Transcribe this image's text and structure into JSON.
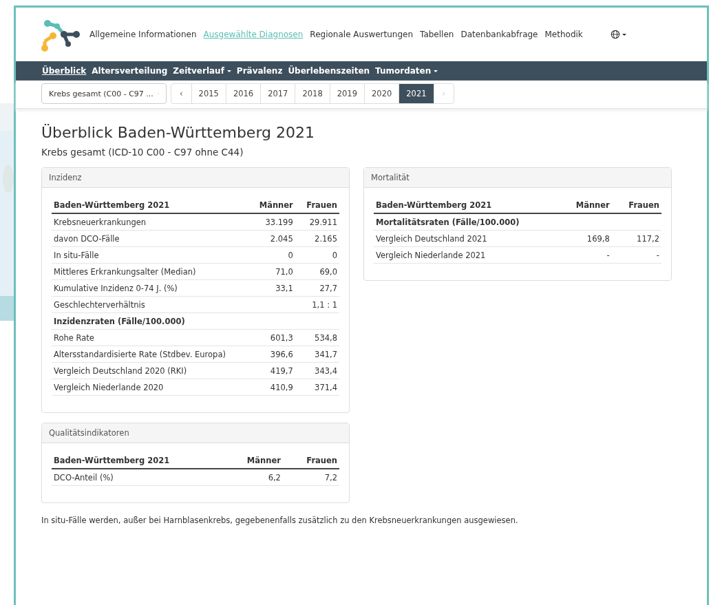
{
  "top_nav": {
    "items": [
      {
        "label": "Allgemeine Informationen",
        "selected": false
      },
      {
        "label": "Ausgewählte Diagnosen",
        "selected": true
      },
      {
        "label": "Regionale Auswertungen",
        "selected": false
      },
      {
        "label": "Tabellen",
        "selected": false
      },
      {
        "label": "Datenbankabfrage",
        "selected": false
      },
      {
        "label": "Methodik",
        "selected": false
      }
    ]
  },
  "sub_nav": {
    "items": [
      {
        "label": "Überblick",
        "selected": true,
        "dropdown": false
      },
      {
        "label": "Altersverteilung",
        "selected": false,
        "dropdown": false
      },
      {
        "label": "Zeitverlauf",
        "selected": false,
        "dropdown": true
      },
      {
        "label": "Prävalenz",
        "selected": false,
        "dropdown": false
      },
      {
        "label": "Überlebenszeiten",
        "selected": false,
        "dropdown": false
      },
      {
        "label": "Tumordaten",
        "selected": false,
        "dropdown": true
      }
    ]
  },
  "diagnosis_select": {
    "value": "Krebs gesamt (C00 - C97 ..."
  },
  "year_pager": {
    "prev": {
      "label": "‹",
      "disabled": false
    },
    "next": {
      "label": "›",
      "disabled": true
    },
    "years": [
      {
        "label": "2015",
        "selected": false
      },
      {
        "label": "2016",
        "selected": false
      },
      {
        "label": "2017",
        "selected": false
      },
      {
        "label": "2018",
        "selected": false
      },
      {
        "label": "2019",
        "selected": false
      },
      {
        "label": "2020",
        "selected": false
      },
      {
        "label": "2021",
        "selected": true
      }
    ]
  },
  "title": "Überblick Baden-Württemberg 2021",
  "subtitle": "Krebs gesamt (ICD-10 C00 - C97 ohne C44)",
  "left_column": {
    "cards": [
      {
        "title": "Inzidenz",
        "columns": [
          "Baden-Württemberg 2021",
          "Männer",
          "Frauen"
        ],
        "rows": [
          {
            "kind": "data",
            "cells": [
              "Krebsneuerkrankungen",
              "33.199",
              "29.911"
            ]
          },
          {
            "kind": "data",
            "cells": [
              "davon DCO-Fälle",
              "2.045",
              "2.165"
            ]
          },
          {
            "kind": "data",
            "cells": [
              "In situ-Fälle",
              "0",
              "0"
            ]
          },
          {
            "kind": "data",
            "cells": [
              "Mittleres Erkrankungsalter (Median)",
              "71,0",
              "69,0"
            ]
          },
          {
            "kind": "data",
            "cells": [
              "Kumulative Inzidenz 0-74 J. (%)",
              "33,1",
              "27,7"
            ]
          },
          {
            "kind": "data",
            "cells": [
              "Geschlechterverhältnis",
              "",
              "1,1 : 1"
            ]
          },
          {
            "kind": "section",
            "cells": [
              "Inzidenzraten (Fälle/100.000)",
              "",
              ""
            ]
          },
          {
            "kind": "data",
            "cells": [
              "Rohe Rate",
              "601,3",
              "534,8"
            ]
          },
          {
            "kind": "data",
            "cells": [
              "Altersstandardisierte Rate (Stdbev. Europa)",
              "396,6",
              "341,7"
            ]
          },
          {
            "kind": "data",
            "cells": [
              "Vergleich Deutschland 2020 (RKI)",
              "419,7",
              "343,4"
            ]
          },
          {
            "kind": "data",
            "cells": [
              "Vergleich Niederlande 2020",
              "410,9",
              "371,4"
            ]
          }
        ]
      },
      {
        "title": "Qualitätsindikatoren",
        "columns": [
          "Baden-Württemberg 2021",
          "Männer",
          "Frauen"
        ],
        "rows": [
          {
            "kind": "data",
            "cells": [
              "DCO-Anteil (%)",
              "6,2",
              "7,2"
            ]
          }
        ]
      }
    ]
  },
  "right_column": {
    "cards": [
      {
        "title": "Mortalität",
        "columns": [
          "Baden-Württemberg 2021",
          "Männer",
          "Frauen"
        ],
        "rows": [
          {
            "kind": "section",
            "cells": [
              "Mortalitätsraten (Fälle/100.000)",
              "",
              ""
            ]
          },
          {
            "kind": "data",
            "cells": [
              "Vergleich Deutschland 2021",
              "169,8",
              "117,2"
            ]
          },
          {
            "kind": "data",
            "cells": [
              "Vergleich Niederlande 2021",
              "-",
              "-"
            ]
          }
        ]
      }
    ]
  },
  "footnote": "In situ-Fälle werden, außer bei Harnblasenkrebs, gegebenenfalls zusätzlich zu den Krebsneuerkrankungen ausgewiesen."
}
